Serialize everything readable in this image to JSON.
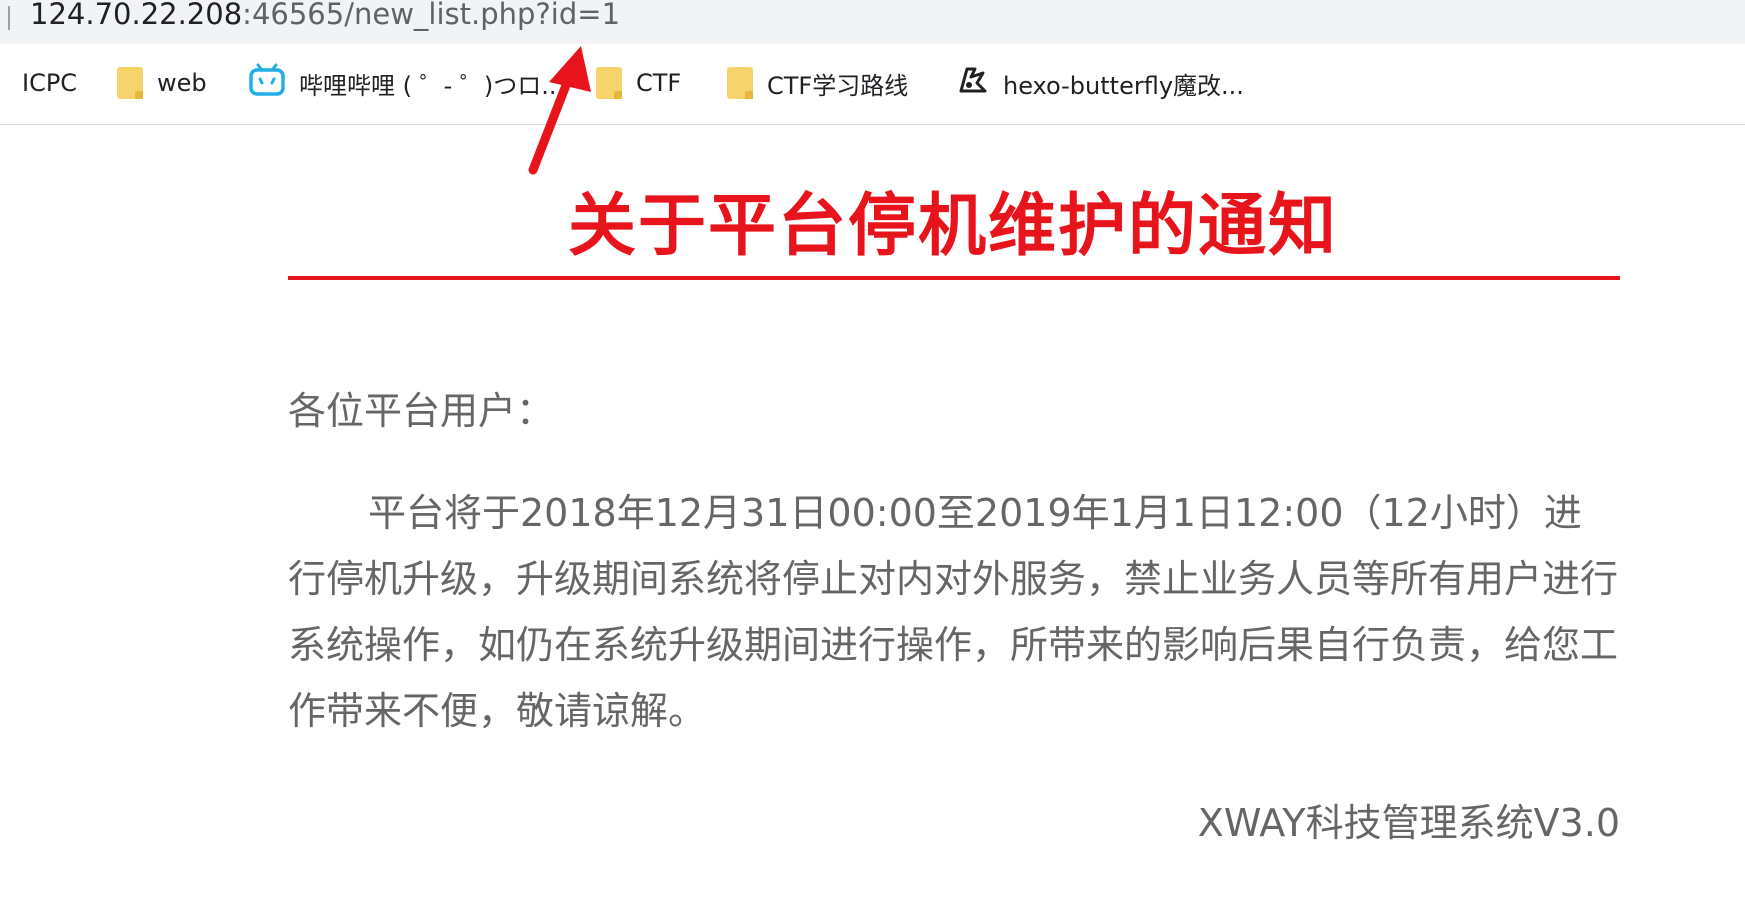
{
  "address_bar": {
    "url_host": "124.70.22.208",
    "url_rest": ":46565/new_list.php?id=1"
  },
  "bookmarks": [
    {
      "label": "ICPC",
      "icon": "none"
    },
    {
      "label": "web",
      "icon": "folder-icon"
    },
    {
      "label": "哔哩哔哩 ( ゜- ゜)つロ...",
      "icon": "bilibili-icon"
    },
    {
      "label": "CTF",
      "icon": "folder-icon"
    },
    {
      "label": "CTF学习路线",
      "icon": "folder-icon"
    },
    {
      "label": "hexo-butterfly魔改...",
      "icon": "hexo-butterfly-icon"
    }
  ],
  "notice": {
    "title": "关于平台停机维护的通知",
    "greeting": "各位平台用户：",
    "body": "平台将于2018年12月31日00:00至2019年1月1日12:00（12小时）进行停机升级，升级期间系统将停止对内对外服务，禁止业务人员等所有用户进行系统操作，如仍在系统升级期间进行操作，所带来的影响后果自行负责，给您工作带来不便，敬请谅解。",
    "signature": "XWAY科技管理系统V3.0"
  },
  "colors": {
    "title_red": "#e8141c",
    "body_gray": "#666666",
    "annotation_arrow": "#e8141c",
    "folder_yellow": "#f7d36b",
    "bilibili_blue": "#23ade5"
  }
}
